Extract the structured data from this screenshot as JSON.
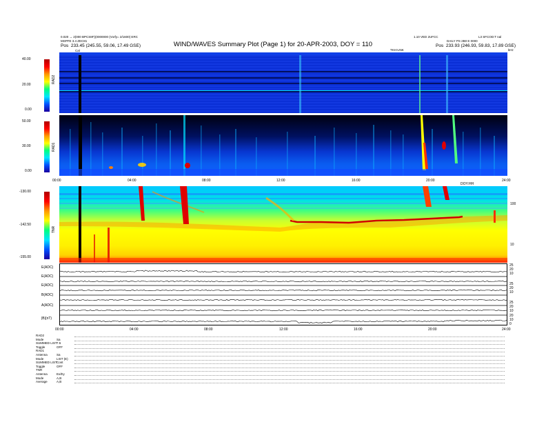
{
  "header": {
    "title": "WIND/WAVES Summary Plot (Page 1) for 20-APR-2003, DOY = 110",
    "left_line1": "0.020 → 2(000 BPCS8F)(0000000 (Vorfy= 2/1600) ERC",
    "left_line2": "MSPFE 3.4 ZEC81",
    "left_pos_label": "Pos",
    "left_pos_value": "233.45 (245.55, 59.06, 17.49 GSE)",
    "right_line1": "1.10 VED 2UFCC",
    "right_line1b": "L3 SFCOD:T nal",
    "right_line2": "DAILY PS 2B0 E 0000",
    "right_pos_label": "Pos",
    "right_pos_value": "233.93 (246.93, 59.83, 17.89 GSE)",
    "top_axis_label": "TKH:UNK",
    "top_axis_corner": "kHz",
    "cal_marker": "Cal"
  },
  "chart_data": [
    {
      "type": "heatmap",
      "name": "RAD2",
      "ylabel": "RAD2",
      "colorbar_ticks": [
        "40.00",
        "20.00",
        "0.00"
      ],
      "ylim": [
        0,
        40
      ],
      "bright_bursts_hours": [
        12.6,
        19.3,
        20.7
      ]
    },
    {
      "type": "heatmap",
      "name": "RAD1",
      "ylabel": "RAD1",
      "colorbar_ticks": [
        "50.00",
        "30.00",
        "0.00"
      ],
      "ylim": [
        0,
        50
      ],
      "bright_bursts_hours": [
        1.9,
        3.3,
        6.0,
        12.8,
        18.0,
        19.3,
        20.3,
        21.0
      ]
    },
    {
      "type": "heatmap",
      "name": "TNR",
      "ylabel": "TNR",
      "colorbar_ticks": [
        "-130.00",
        "-142.50",
        "-155.00"
      ],
      "ylim": [
        -155,
        -130
      ],
      "right_ticks": [
        "100",
        "10"
      ],
      "right_label": "kHz",
      "plasma_line_hours": [
        12.0,
        22.5
      ],
      "x_ticks": [
        "00:00",
        "04:00",
        "08:00",
        "12:00",
        "16:00",
        "20:00",
        "24:00"
      ],
      "x_label": "DOY:HH"
    },
    {
      "type": "line",
      "name": "Housekeeping",
      "series": [
        {
          "name": "E(ADC)",
          "right_ticks": [
            "25",
            "20",
            "10"
          ]
        },
        {
          "name": "E(ADC)",
          "right_ticks": [
            "25",
            "20",
            "10"
          ]
        },
        {
          "name": "E(ADC)",
          "right_ticks": [
            "25",
            "20",
            "10"
          ]
        },
        {
          "name": "B(ADC)",
          "right_ticks": [
            "25",
            "20",
            "10"
          ]
        },
        {
          "name": "A(ADC)",
          "right_ticks": [
            "25",
            "20",
            "10"
          ]
        },
        {
          "name": "|B|(nT)",
          "right_ticks": [
            "20",
            "10",
            "0"
          ]
        }
      ],
      "x_ticks": [
        "00:00",
        "04:00",
        "08:00",
        "12:00",
        "16:00",
        "20:00",
        "24:00"
      ]
    }
  ],
  "footer": [
    {
      "label": "RAD2",
      "value": ""
    },
    {
      "label": "Mode",
      "value": "Sa"
    },
    {
      "label": "SUMMED LIST",
      "value": "7.5"
    },
    {
      "label": "Toggle",
      "value": "OFF"
    },
    {
      "label": "RAD1",
      "value": ""
    },
    {
      "label": "Antenna",
      "value": "Sa"
    },
    {
      "label": "Mode",
      "value": "LIST (E)"
    },
    {
      "label": "SUMMED LIST",
      "value": "Cont"
    },
    {
      "label": "Toggle",
      "value": "OFF"
    },
    {
      "label": "TNR",
      "value": ""
    },
    {
      "label": "Antenna",
      "value": "Ex/Ey"
    },
    {
      "label": "Mode",
      "value": "A,B"
    },
    {
      "label": "Average",
      "value": "A,B"
    }
  ],
  "colors": {
    "bg_blue": "#0a2fd6",
    "deep_blue": "#001a9e",
    "cyan": "#00d4ff",
    "yellow": "#fff000",
    "red": "#e00000"
  }
}
